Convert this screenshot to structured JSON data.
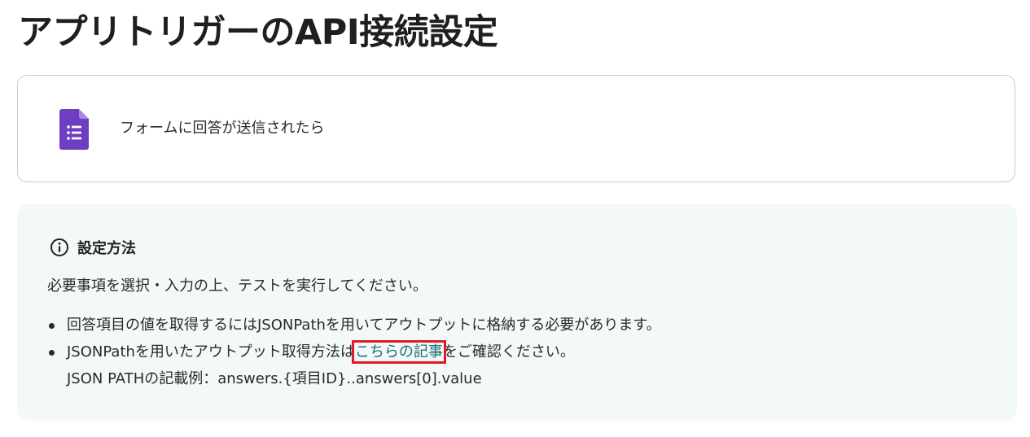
{
  "page": {
    "title": "アプリトリガーのAPI接続設定"
  },
  "trigger": {
    "app_icon": "google-forms-icon",
    "label": "フォームに回答が送信されたら"
  },
  "info": {
    "icon": "info-circle-icon",
    "title": "設定方法",
    "description": "必要事項を選択・入力の上、テストを実行してください。",
    "bullets": [
      {
        "text": "回答項目の値を取得するにはJSONPathを用いてアウトプットに格納する必要があります。"
      },
      {
        "text_before": "JSONPathを用いたアウトプット取得方法は",
        "link_text": "こちらの記事",
        "text_after": "をご確認ください。",
        "example": "JSON PATHの記載例：answers.{項目ID}..answers[0].value"
      }
    ]
  },
  "colors": {
    "forms_purple": "#6d3fc0",
    "link_teal": "#1b6e78",
    "highlight_red": "#e11b22",
    "panel_bg": "#f2f9f8"
  }
}
